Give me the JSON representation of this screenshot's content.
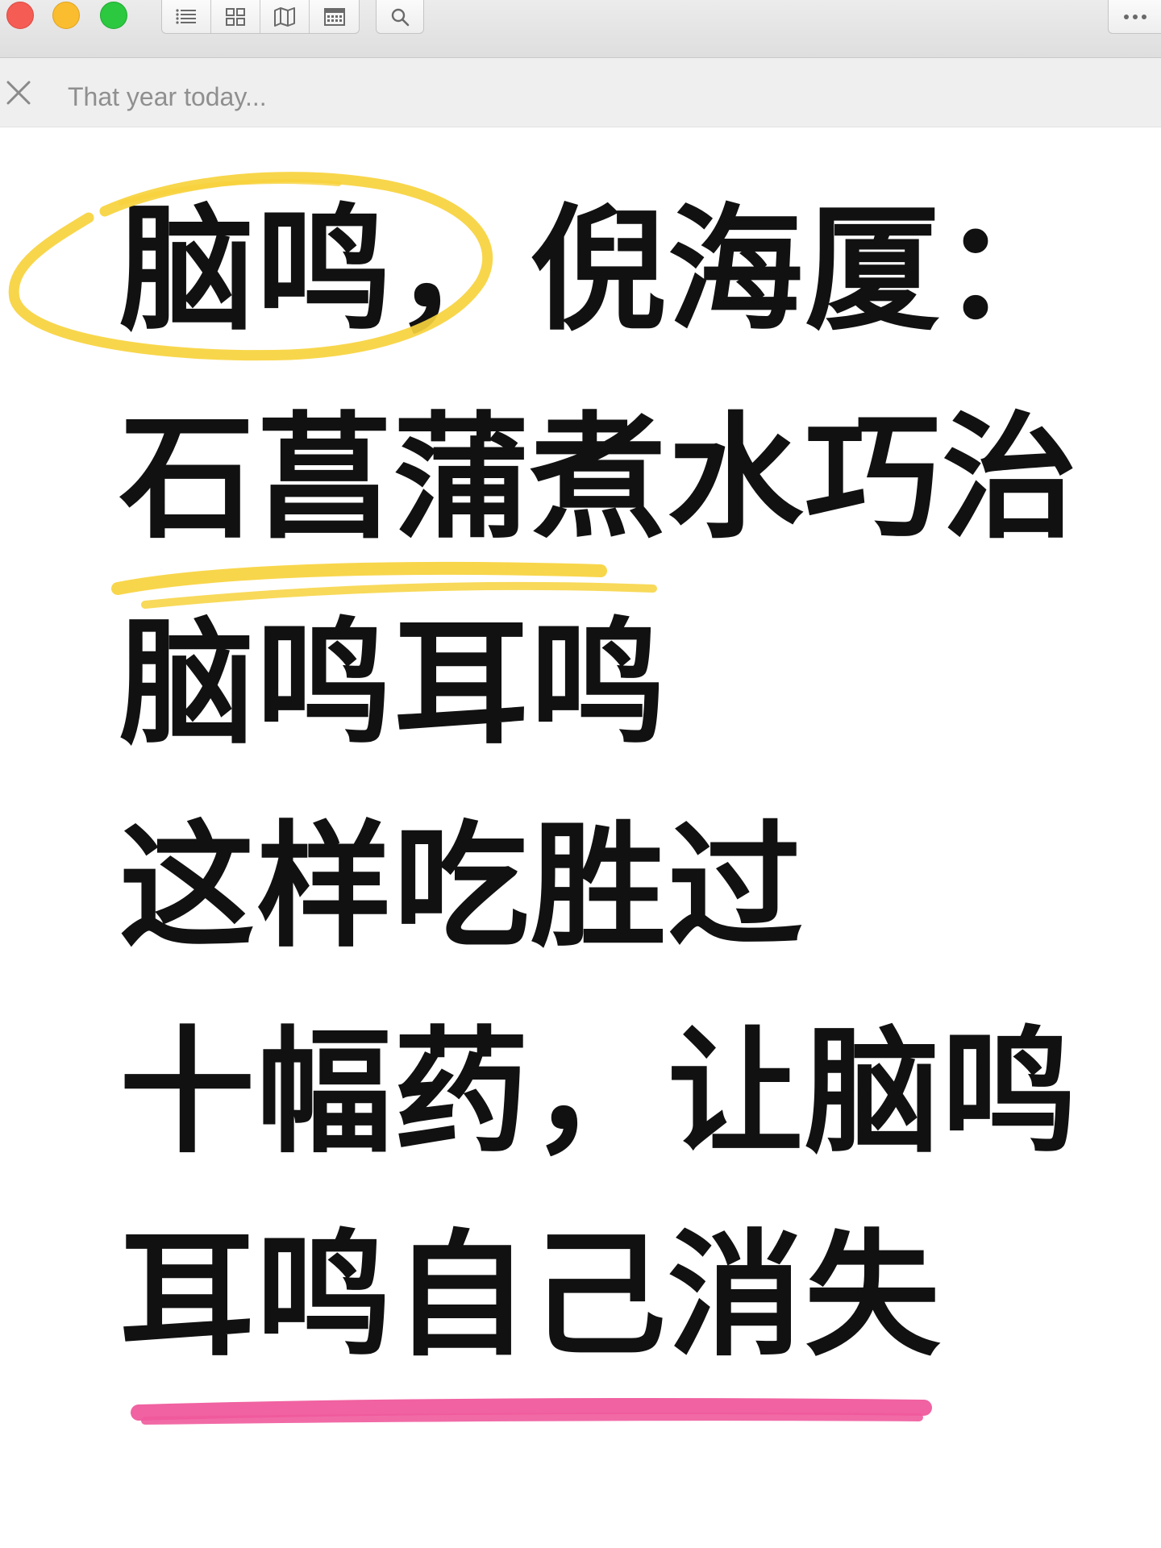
{
  "window": {
    "title": "That year today..."
  },
  "toolbar": {
    "buttons": [
      "list-icon",
      "grid-icon",
      "map-icon",
      "calendar-icon"
    ],
    "search": "search-icon",
    "more": "more-icon"
  },
  "content": {
    "lines": [
      "脑鸣，倪海厦：",
      "石菖蒲煮水巧治",
      "脑鸣耳鸣",
      "这样吃胜过",
      "十幅药，让脑鸣",
      "耳鸣自己消失"
    ]
  },
  "colors": {
    "highlight_yellow": "#f7d23c",
    "underline_pink": "#ef5a9c",
    "text": "#111111"
  }
}
